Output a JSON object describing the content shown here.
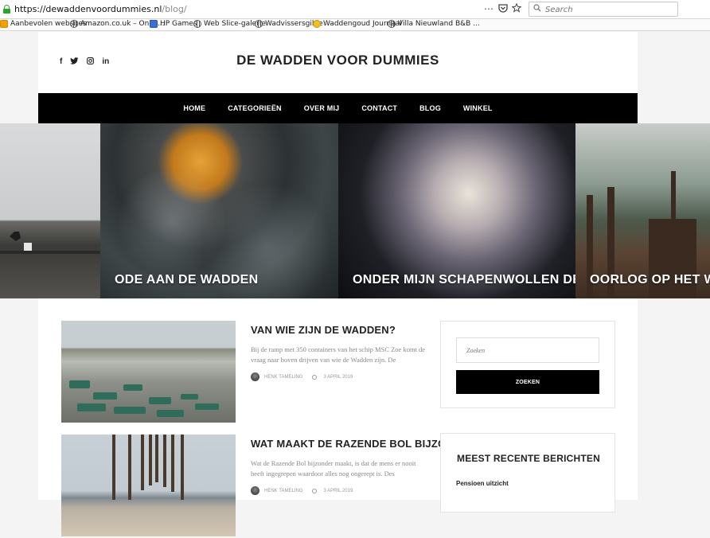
{
  "browser": {
    "url_host": "https://dewaddenvoordummies.nl",
    "url_path": "/blog/",
    "menu_icon": "⋯",
    "search_placeholder": "Search",
    "bookmarks": [
      {
        "label": "Aanbevolen websites",
        "icon": "orange"
      },
      {
        "label": "Amazon.co.uk – Onlin...",
        "icon": "globe"
      },
      {
        "label": "HP Games",
        "icon": "blue"
      },
      {
        "label": "Web Slice-galerie",
        "icon": "globe"
      },
      {
        "label": "Wadvissersgilde",
        "icon": "globe"
      },
      {
        "label": "Waddengoud Journaal",
        "icon": "yellow"
      },
      {
        "label": "Villa Nieuwland B&B ...",
        "icon": "globe"
      }
    ]
  },
  "site": {
    "title": "DE WADDEN VOOR DUMMIES",
    "social": [
      "f",
      "t",
      "ig",
      "in"
    ]
  },
  "nav": {
    "items": [
      "HOME",
      "CATEGORIEËN",
      "OVER MIJ",
      "CONTACT",
      "BLOG",
      "WINKEL"
    ]
  },
  "slider": {
    "slides": [
      {
        "title": ""
      },
      {
        "title": "ODE AAN DE WADDEN"
      },
      {
        "title": "ONDER MIJN SCHAPENWOLLEN DEKEN"
      },
      {
        "title": "OORLOG OP HET WAD"
      }
    ]
  },
  "posts": [
    {
      "title": "VAN WIE ZIJN DE WADDEN?",
      "excerpt": "Bij de ramp met 350 containers van het schip MSC Zoe komt de vraag naar boven drijven van wie de Wadden zijn. De",
      "author": "HENK TAMELING",
      "date": "3 APRIL 2019"
    },
    {
      "title": "WAT MAAKT DE RAZENDE BOL BIJZONDER?",
      "excerpt": "Wat de Razende Bol bijzonder maakt, is dat de mens er nooit heeft ingegrepen waardoor alles nog ongerept is. Des",
      "author": "HENK TAMELING",
      "date": "3 APRIL 2019"
    }
  ],
  "sidebar": {
    "search_placeholder": "Zoeken",
    "search_button": "ZOEKEN",
    "recent_title": "MEEST RECENTE BERICHTEN",
    "recent_items": [
      "Pensioen uitzicht"
    ]
  }
}
